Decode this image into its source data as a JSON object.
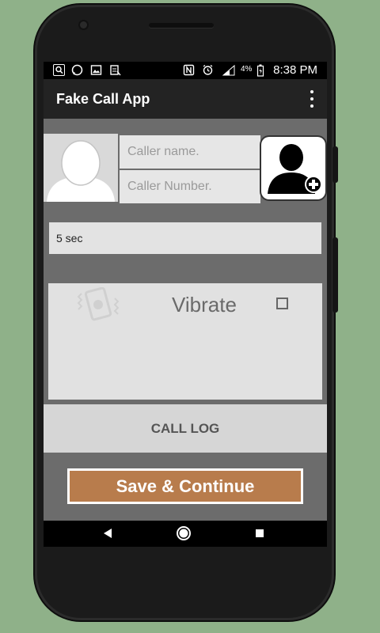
{
  "status_bar": {
    "time": "8:38 PM",
    "battery": "4%",
    "icons": [
      "search-icon",
      "whatsapp-icon",
      "gallery-icon",
      "app-icon",
      "nfc-icon",
      "alarm-icon",
      "signal-icon",
      "battery-icon"
    ]
  },
  "app_bar": {
    "title": "Fake Call App",
    "menu_icon": "more-vert-icon"
  },
  "form": {
    "caller_name_placeholder": "Caller name.",
    "caller_number_placeholder": "Caller Number.",
    "caller_name_value": "",
    "caller_number_value": ""
  },
  "delay": {
    "value": "5 sec"
  },
  "vibrate": {
    "label": "Vibrate",
    "checked": false
  },
  "buttons": {
    "call_log": "CALL LOG",
    "save_continue": "Save  & Continue"
  },
  "colors": {
    "background": "#8fb189",
    "save_button": "#b87c4c",
    "app_bar": "#232323"
  }
}
